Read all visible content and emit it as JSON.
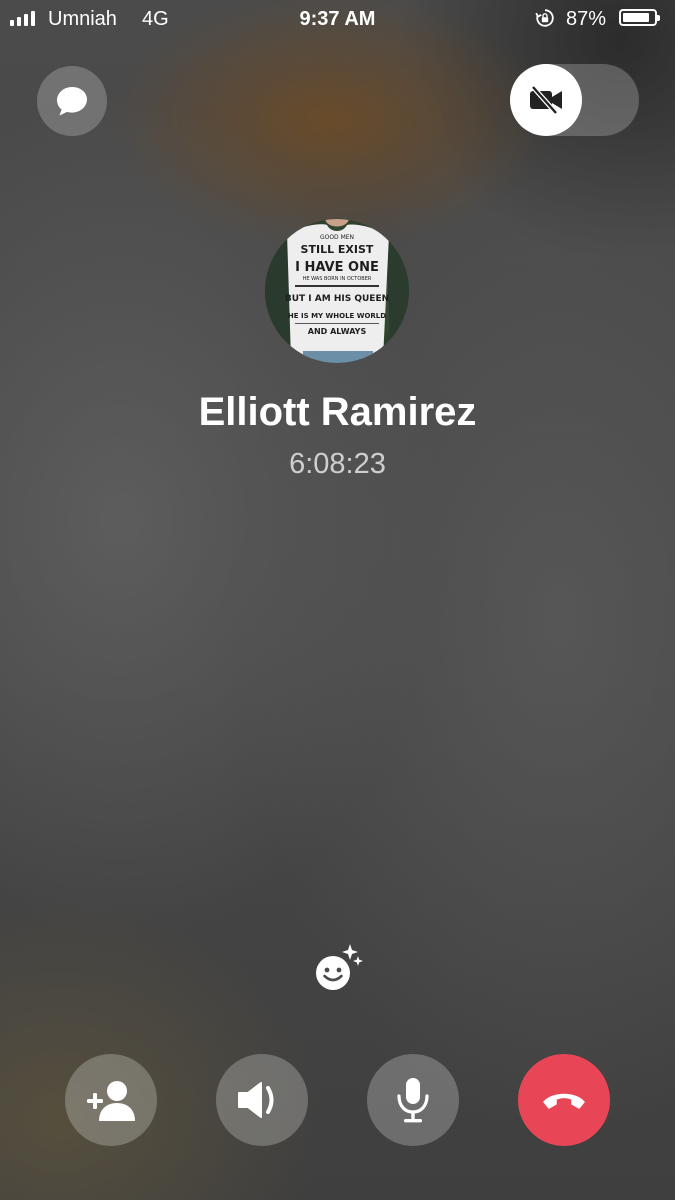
{
  "status_bar": {
    "carrier": "Umniah",
    "network": "4G",
    "time": "9:37 AM",
    "battery_percent": "87%",
    "battery_level": 0.87,
    "signal_bars": 4,
    "icons": [
      "signal-bars-icon",
      "rotation-lock-icon",
      "battery-icon"
    ]
  },
  "controls": {
    "top": [
      "chat-icon",
      "video-off-icon"
    ],
    "effects": "smiley-sparkle-icon",
    "bottom": [
      "add-person-icon",
      "speaker-icon",
      "microphone-icon",
      "end-call-icon"
    ]
  },
  "call": {
    "contact_name": "Elliott Ramirez",
    "duration": "6:08:23"
  },
  "avatar_shirt_text": [
    "GOOD MEN",
    "STILL EXIST",
    "I HAVE ONE",
    "HE WAS BORN IN OCTOBER",
    "BUT I AM HIS QUEEN",
    "HE IS MY WHOLE WORLD",
    "AND ALWAYS"
  ],
  "colors": {
    "end_call": "#e84656",
    "button_bg": "rgba(255,255,255,0.24)",
    "duration_text": "rgba(255,255,255,0.72)"
  }
}
